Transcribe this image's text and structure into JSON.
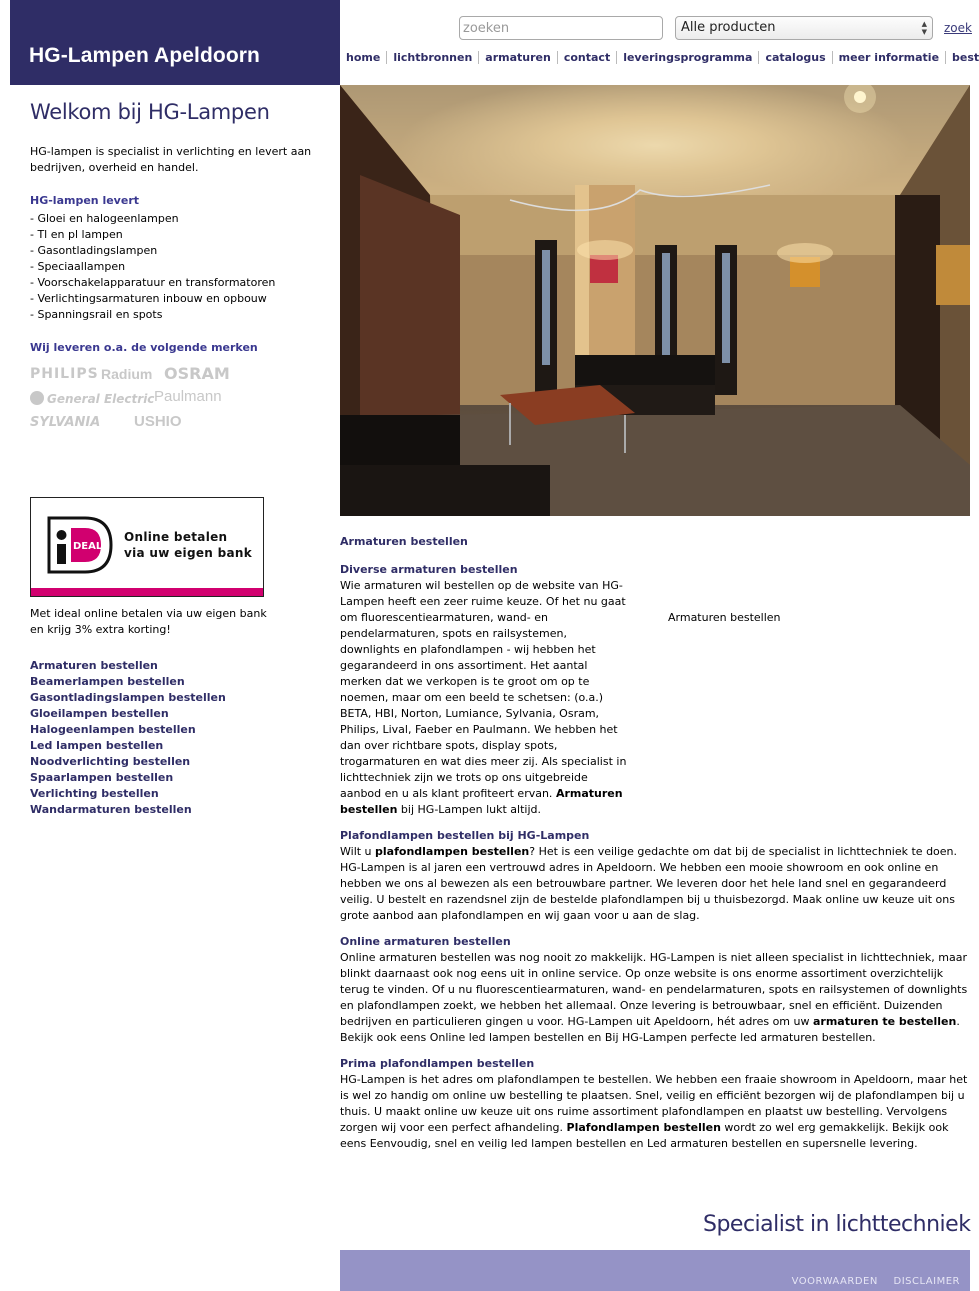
{
  "header": {
    "site_title": "HG-Lampen Apeldoorn",
    "search_placeholder": "zoeken",
    "product_select": "Alle producten",
    "search_button": "zoek",
    "nav": [
      "home",
      "lichtbronnen",
      "armaturen",
      "contact",
      "leveringsprogramma",
      "catalogus",
      "meer informatie",
      "bestellijst"
    ]
  },
  "sidebar": {
    "title": "Welkom bij HG-Lampen",
    "intro": "HG-lampen is specialist in verlichting en levert aan bedrijven, overheid en handel.",
    "levert_heading": "HG-lampen levert",
    "levert_items": [
      "- Gloei en halogeenlampen",
      "- Tl en pl lampen",
      "- Gasontladingslampen",
      "- Speciaallampen",
      "- Voorschakelapparatuur en transformatoren",
      "- Verlichtingsarmaturen inbouw en opbouw",
      "- Spanningsrail en spots"
    ],
    "brands_heading": "Wij leveren o.a. de volgende merken",
    "brands": [
      "PHILIPS",
      "Radium",
      "OSRAM",
      "General Electric",
      "Paulmann",
      "SYLVANIA",
      "USHIO"
    ],
    "ideal_line1": "Online betalen",
    "ideal_line2": "via uw eigen bank",
    "ideal_caption": "Met ideal online betalen via uw eigen bank en krijg 3% extra korting!",
    "links": [
      "Armaturen bestellen",
      "Beamerlampen bestellen",
      "Gasontladingslampen bestellen",
      "Gloeilampen bestellen",
      "Halogeenlampen bestellen",
      "Led lampen bestellen",
      "Noodverlichting bestellen",
      "Spaarlampen bestellen",
      "Verlichting bestellen",
      "Wandarmaturen bestellen"
    ]
  },
  "content": {
    "page_heading": "Armaturen bestellen",
    "s1_title": "Diverse armaturen bestellen",
    "s1_text": "Wie armaturen wil bestellen op de website van HG-Lampen heeft een zeer ruime keuze. Of het nu gaat om fluorescentiearmaturen, wand- en pendelarmaturen, spots en railsystemen, downlights en plafondlampen - wij hebben het gegarandeerd in ons assortiment. Het aantal merken dat we verkopen is te groot om op te noemen, maar om een beeld te schetsen: (o.a.) BETA, HBI, Norton, Lumiance, Sylvania, Osram, Philips, Lival, Faeber en Paulmann. We hebben het dan over richtbare spots, display spots, trogarmaturen en wat dies meer zij. Als specialist in lichttechniek zijn we trots op ons uitgebreide aanbod en u als klant profiteert ervan.",
    "s1_bold": "Armaturen bestellen",
    "s1_tail": " bij HG-Lampen lukt altijd.",
    "s1_side": "Armaturen bestellen",
    "s2_title": "Plafondlampen bestellen bij HG-Lampen",
    "s2_pre": "Wilt u ",
    "s2_bold": "plafondlampen bestellen",
    "s2_text": "? Het is een veilige gedachte om dat bij de specialist in lichttechniek te doen. HG-Lampen is al jaren een vertrouwd adres in Apeldoorn. We hebben een mooie showroom en ook online en hebben we ons al bewezen als een betrouwbare partner. We leveren door het hele land snel en gegarandeerd veilig. U bestelt en razendsnel zijn de bestelde plafondlampen bij u thuisbezorgd. Maak online uw keuze uit ons grote aanbod aan plafondlampen en wij gaan voor u aan de slag.",
    "s3_title": "Online armaturen bestellen",
    "s3_text": "Online armaturen bestellen was nog nooit zo makkelijk. HG-Lampen is niet alleen specialist in lichttechniek, maar blinkt daarnaast ook nog eens uit in online service. Op onze website is ons enorme assortiment overzichtelijk terug te vinden. Of u nu fluorescentiearmaturen, wand- en pendelarmaturen, spots en railsystemen of downlights en plafondlampen zoekt, we hebben het allemaal. Onze levering is betrouwbaar, snel en efficiënt. Duizenden bedrijven en particulieren gingen u voor. HG-Lampen uit Apeldoorn, hét adres om uw ",
    "s3_bold": "armaturen te bestellen",
    "s3_tail": ". Bekijk ook eens Online led lampen bestellen en Bij HG-Lampen perfecte led armaturen bestellen.",
    "s4_title": "Prima plafondlampen bestellen",
    "s4_text": "HG-Lampen is het adres om plafondlampen te bestellen. We hebben een fraaie showroom in Apeldoorn, maar het is wel zo handig om online uw bestelling te plaatsen. Snel, veilig en efficiënt bezorgen wij de plafondlampen bij u thuis. U maakt online uw keuze uit ons ruime assortiment plafondlampen en plaatst uw bestelling. Vervolgens zorgen wij voor een perfect afhandeling. ",
    "s4_bold": "Plafondlampen bestellen",
    "s4_tail": " wordt zo wel erg gemakkelijk. Bekijk ook eens Eenvoudig, snel en veilig led lampen bestellen en Led armaturen bestellen en supersnelle levering."
  },
  "footer": {
    "slogan": "Specialist in lichttechniek",
    "link_terms": "VOORWAARDEN",
    "link_disclaimer": "DISCLAIMER"
  },
  "colors": {
    "brand_navy": "#2f2d66",
    "footer_lavender": "#9593c6",
    "ideal_pink": "#d1006f"
  }
}
